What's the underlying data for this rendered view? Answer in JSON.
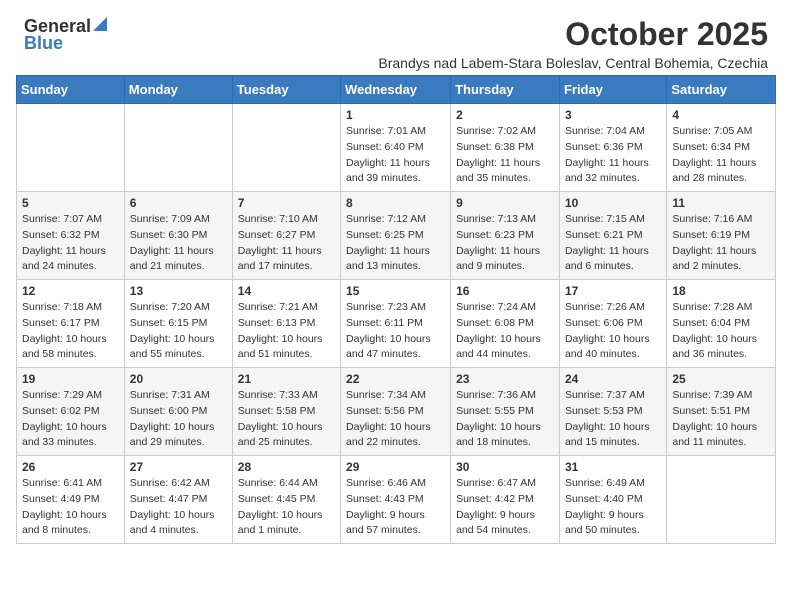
{
  "header": {
    "logo_general": "General",
    "logo_blue": "Blue",
    "title": "October 2025",
    "subtitle": "Brandys nad Labem-Stara Boleslav, Central Bohemia, Czechia"
  },
  "days_of_week": [
    "Sunday",
    "Monday",
    "Tuesday",
    "Wednesday",
    "Thursday",
    "Friday",
    "Saturday"
  ],
  "weeks": [
    [
      {
        "day": "",
        "content": ""
      },
      {
        "day": "",
        "content": ""
      },
      {
        "day": "",
        "content": ""
      },
      {
        "day": "1",
        "content": "Sunrise: 7:01 AM\nSunset: 6:40 PM\nDaylight: 11 hours and 39 minutes."
      },
      {
        "day": "2",
        "content": "Sunrise: 7:02 AM\nSunset: 6:38 PM\nDaylight: 11 hours and 35 minutes."
      },
      {
        "day": "3",
        "content": "Sunrise: 7:04 AM\nSunset: 6:36 PM\nDaylight: 11 hours and 32 minutes."
      },
      {
        "day": "4",
        "content": "Sunrise: 7:05 AM\nSunset: 6:34 PM\nDaylight: 11 hours and 28 minutes."
      }
    ],
    [
      {
        "day": "5",
        "content": "Sunrise: 7:07 AM\nSunset: 6:32 PM\nDaylight: 11 hours and 24 minutes."
      },
      {
        "day": "6",
        "content": "Sunrise: 7:09 AM\nSunset: 6:30 PM\nDaylight: 11 hours and 21 minutes."
      },
      {
        "day": "7",
        "content": "Sunrise: 7:10 AM\nSunset: 6:27 PM\nDaylight: 11 hours and 17 minutes."
      },
      {
        "day": "8",
        "content": "Sunrise: 7:12 AM\nSunset: 6:25 PM\nDaylight: 11 hours and 13 minutes."
      },
      {
        "day": "9",
        "content": "Sunrise: 7:13 AM\nSunset: 6:23 PM\nDaylight: 11 hours and 9 minutes."
      },
      {
        "day": "10",
        "content": "Sunrise: 7:15 AM\nSunset: 6:21 PM\nDaylight: 11 hours and 6 minutes."
      },
      {
        "day": "11",
        "content": "Sunrise: 7:16 AM\nSunset: 6:19 PM\nDaylight: 11 hours and 2 minutes."
      }
    ],
    [
      {
        "day": "12",
        "content": "Sunrise: 7:18 AM\nSunset: 6:17 PM\nDaylight: 10 hours and 58 minutes."
      },
      {
        "day": "13",
        "content": "Sunrise: 7:20 AM\nSunset: 6:15 PM\nDaylight: 10 hours and 55 minutes."
      },
      {
        "day": "14",
        "content": "Sunrise: 7:21 AM\nSunset: 6:13 PM\nDaylight: 10 hours and 51 minutes."
      },
      {
        "day": "15",
        "content": "Sunrise: 7:23 AM\nSunset: 6:11 PM\nDaylight: 10 hours and 47 minutes."
      },
      {
        "day": "16",
        "content": "Sunrise: 7:24 AM\nSunset: 6:08 PM\nDaylight: 10 hours and 44 minutes."
      },
      {
        "day": "17",
        "content": "Sunrise: 7:26 AM\nSunset: 6:06 PM\nDaylight: 10 hours and 40 minutes."
      },
      {
        "day": "18",
        "content": "Sunrise: 7:28 AM\nSunset: 6:04 PM\nDaylight: 10 hours and 36 minutes."
      }
    ],
    [
      {
        "day": "19",
        "content": "Sunrise: 7:29 AM\nSunset: 6:02 PM\nDaylight: 10 hours and 33 minutes."
      },
      {
        "day": "20",
        "content": "Sunrise: 7:31 AM\nSunset: 6:00 PM\nDaylight: 10 hours and 29 minutes."
      },
      {
        "day": "21",
        "content": "Sunrise: 7:33 AM\nSunset: 5:58 PM\nDaylight: 10 hours and 25 minutes."
      },
      {
        "day": "22",
        "content": "Sunrise: 7:34 AM\nSunset: 5:56 PM\nDaylight: 10 hours and 22 minutes."
      },
      {
        "day": "23",
        "content": "Sunrise: 7:36 AM\nSunset: 5:55 PM\nDaylight: 10 hours and 18 minutes."
      },
      {
        "day": "24",
        "content": "Sunrise: 7:37 AM\nSunset: 5:53 PM\nDaylight: 10 hours and 15 minutes."
      },
      {
        "day": "25",
        "content": "Sunrise: 7:39 AM\nSunset: 5:51 PM\nDaylight: 10 hours and 11 minutes."
      }
    ],
    [
      {
        "day": "26",
        "content": "Sunrise: 6:41 AM\nSunset: 4:49 PM\nDaylight: 10 hours and 8 minutes."
      },
      {
        "day": "27",
        "content": "Sunrise: 6:42 AM\nSunset: 4:47 PM\nDaylight: 10 hours and 4 minutes."
      },
      {
        "day": "28",
        "content": "Sunrise: 6:44 AM\nSunset: 4:45 PM\nDaylight: 10 hours and 1 minute."
      },
      {
        "day": "29",
        "content": "Sunrise: 6:46 AM\nSunset: 4:43 PM\nDaylight: 9 hours and 57 minutes."
      },
      {
        "day": "30",
        "content": "Sunrise: 6:47 AM\nSunset: 4:42 PM\nDaylight: 9 hours and 54 minutes."
      },
      {
        "day": "31",
        "content": "Sunrise: 6:49 AM\nSunset: 4:40 PM\nDaylight: 9 hours and 50 minutes."
      },
      {
        "day": "",
        "content": ""
      }
    ]
  ]
}
